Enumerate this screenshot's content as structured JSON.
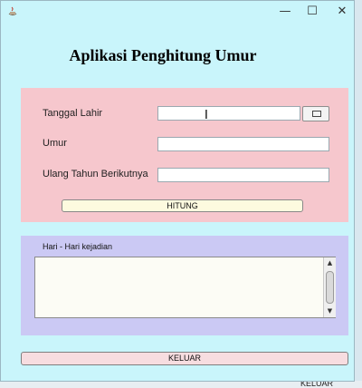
{
  "window": {
    "title": "",
    "minimize_glyph": "—",
    "maximize_glyph": "☐",
    "close_glyph": "✕"
  },
  "app": {
    "heading": "Aplikasi Penghitung Umur"
  },
  "form": {
    "birth_date_label": "Tanggal Lahir",
    "birth_date_value": "",
    "age_label": "Umur",
    "age_value": "",
    "next_birthday_label": "Ulang Tahun Berikutnya",
    "next_birthday_value": "",
    "calculate_button": "HITUNG",
    "date_picker_icon": "calendar-icon"
  },
  "events": {
    "label": "Hari - Hari kejadian",
    "text": ""
  },
  "footer": {
    "exit_button": "KELUAR"
  },
  "background": {
    "peek_text": "KELUAR"
  },
  "colors": {
    "window_bg": "#c9f5fb",
    "form_panel": "#f6c7cd",
    "events_panel": "#cbc9f4",
    "calc_button": "#fdfadf",
    "exit_button": "#f7dde0"
  }
}
